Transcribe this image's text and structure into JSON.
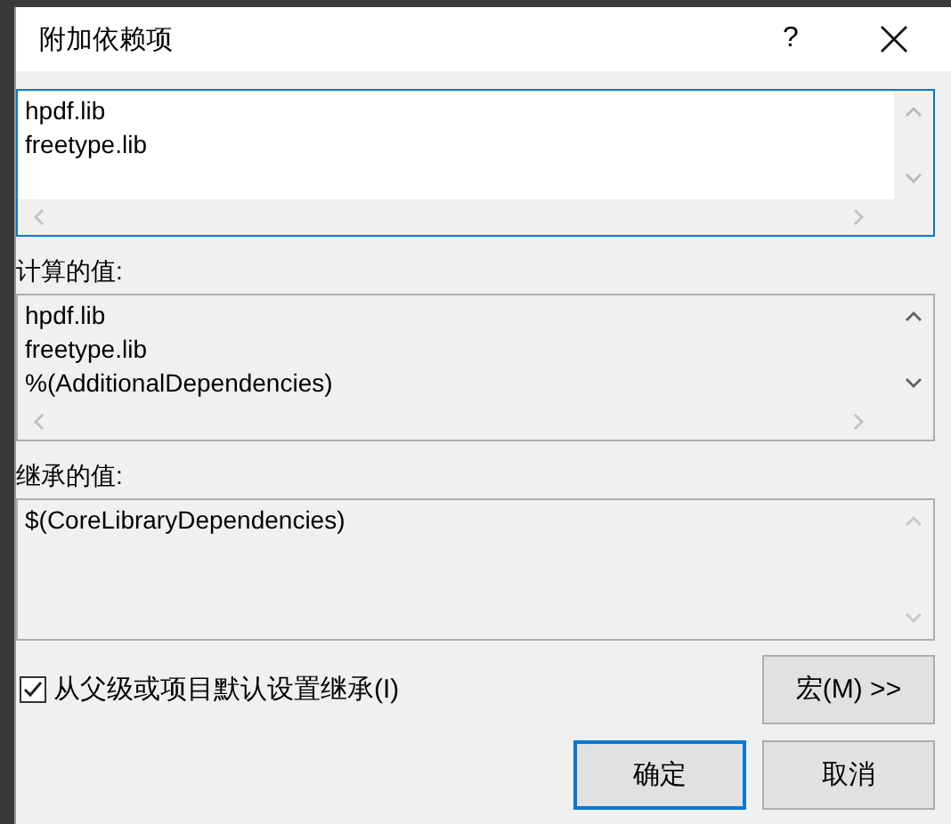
{
  "dialog": {
    "title": "附加依赖项",
    "help": "?"
  },
  "boxes": [
    {
      "editable": true,
      "horizontal_scrollbar": true,
      "lines": [
        "hpdf.lib",
        "freetype.lib"
      ]
    },
    {
      "label": "计算的值:",
      "editable": false,
      "horizontal_scrollbar": true,
      "lines": [
        "hpdf.lib",
        "freetype.lib",
        "%(AdditionalDependencies)"
      ]
    },
    {
      "label": "继承的值:",
      "editable": false,
      "horizontal_scrollbar": false,
      "lines": [
        "$(CoreLibraryDependencies)"
      ]
    }
  ],
  "inherit_checkbox": {
    "label": "从父级或项目默认设置继承(I)",
    "checked": true
  },
  "buttons": [
    {
      "label": "宏(M) >>",
      "kind": "macro"
    },
    {
      "label": "确定",
      "kind": "default"
    },
    {
      "label": "取消",
      "kind": "normal"
    }
  ]
}
